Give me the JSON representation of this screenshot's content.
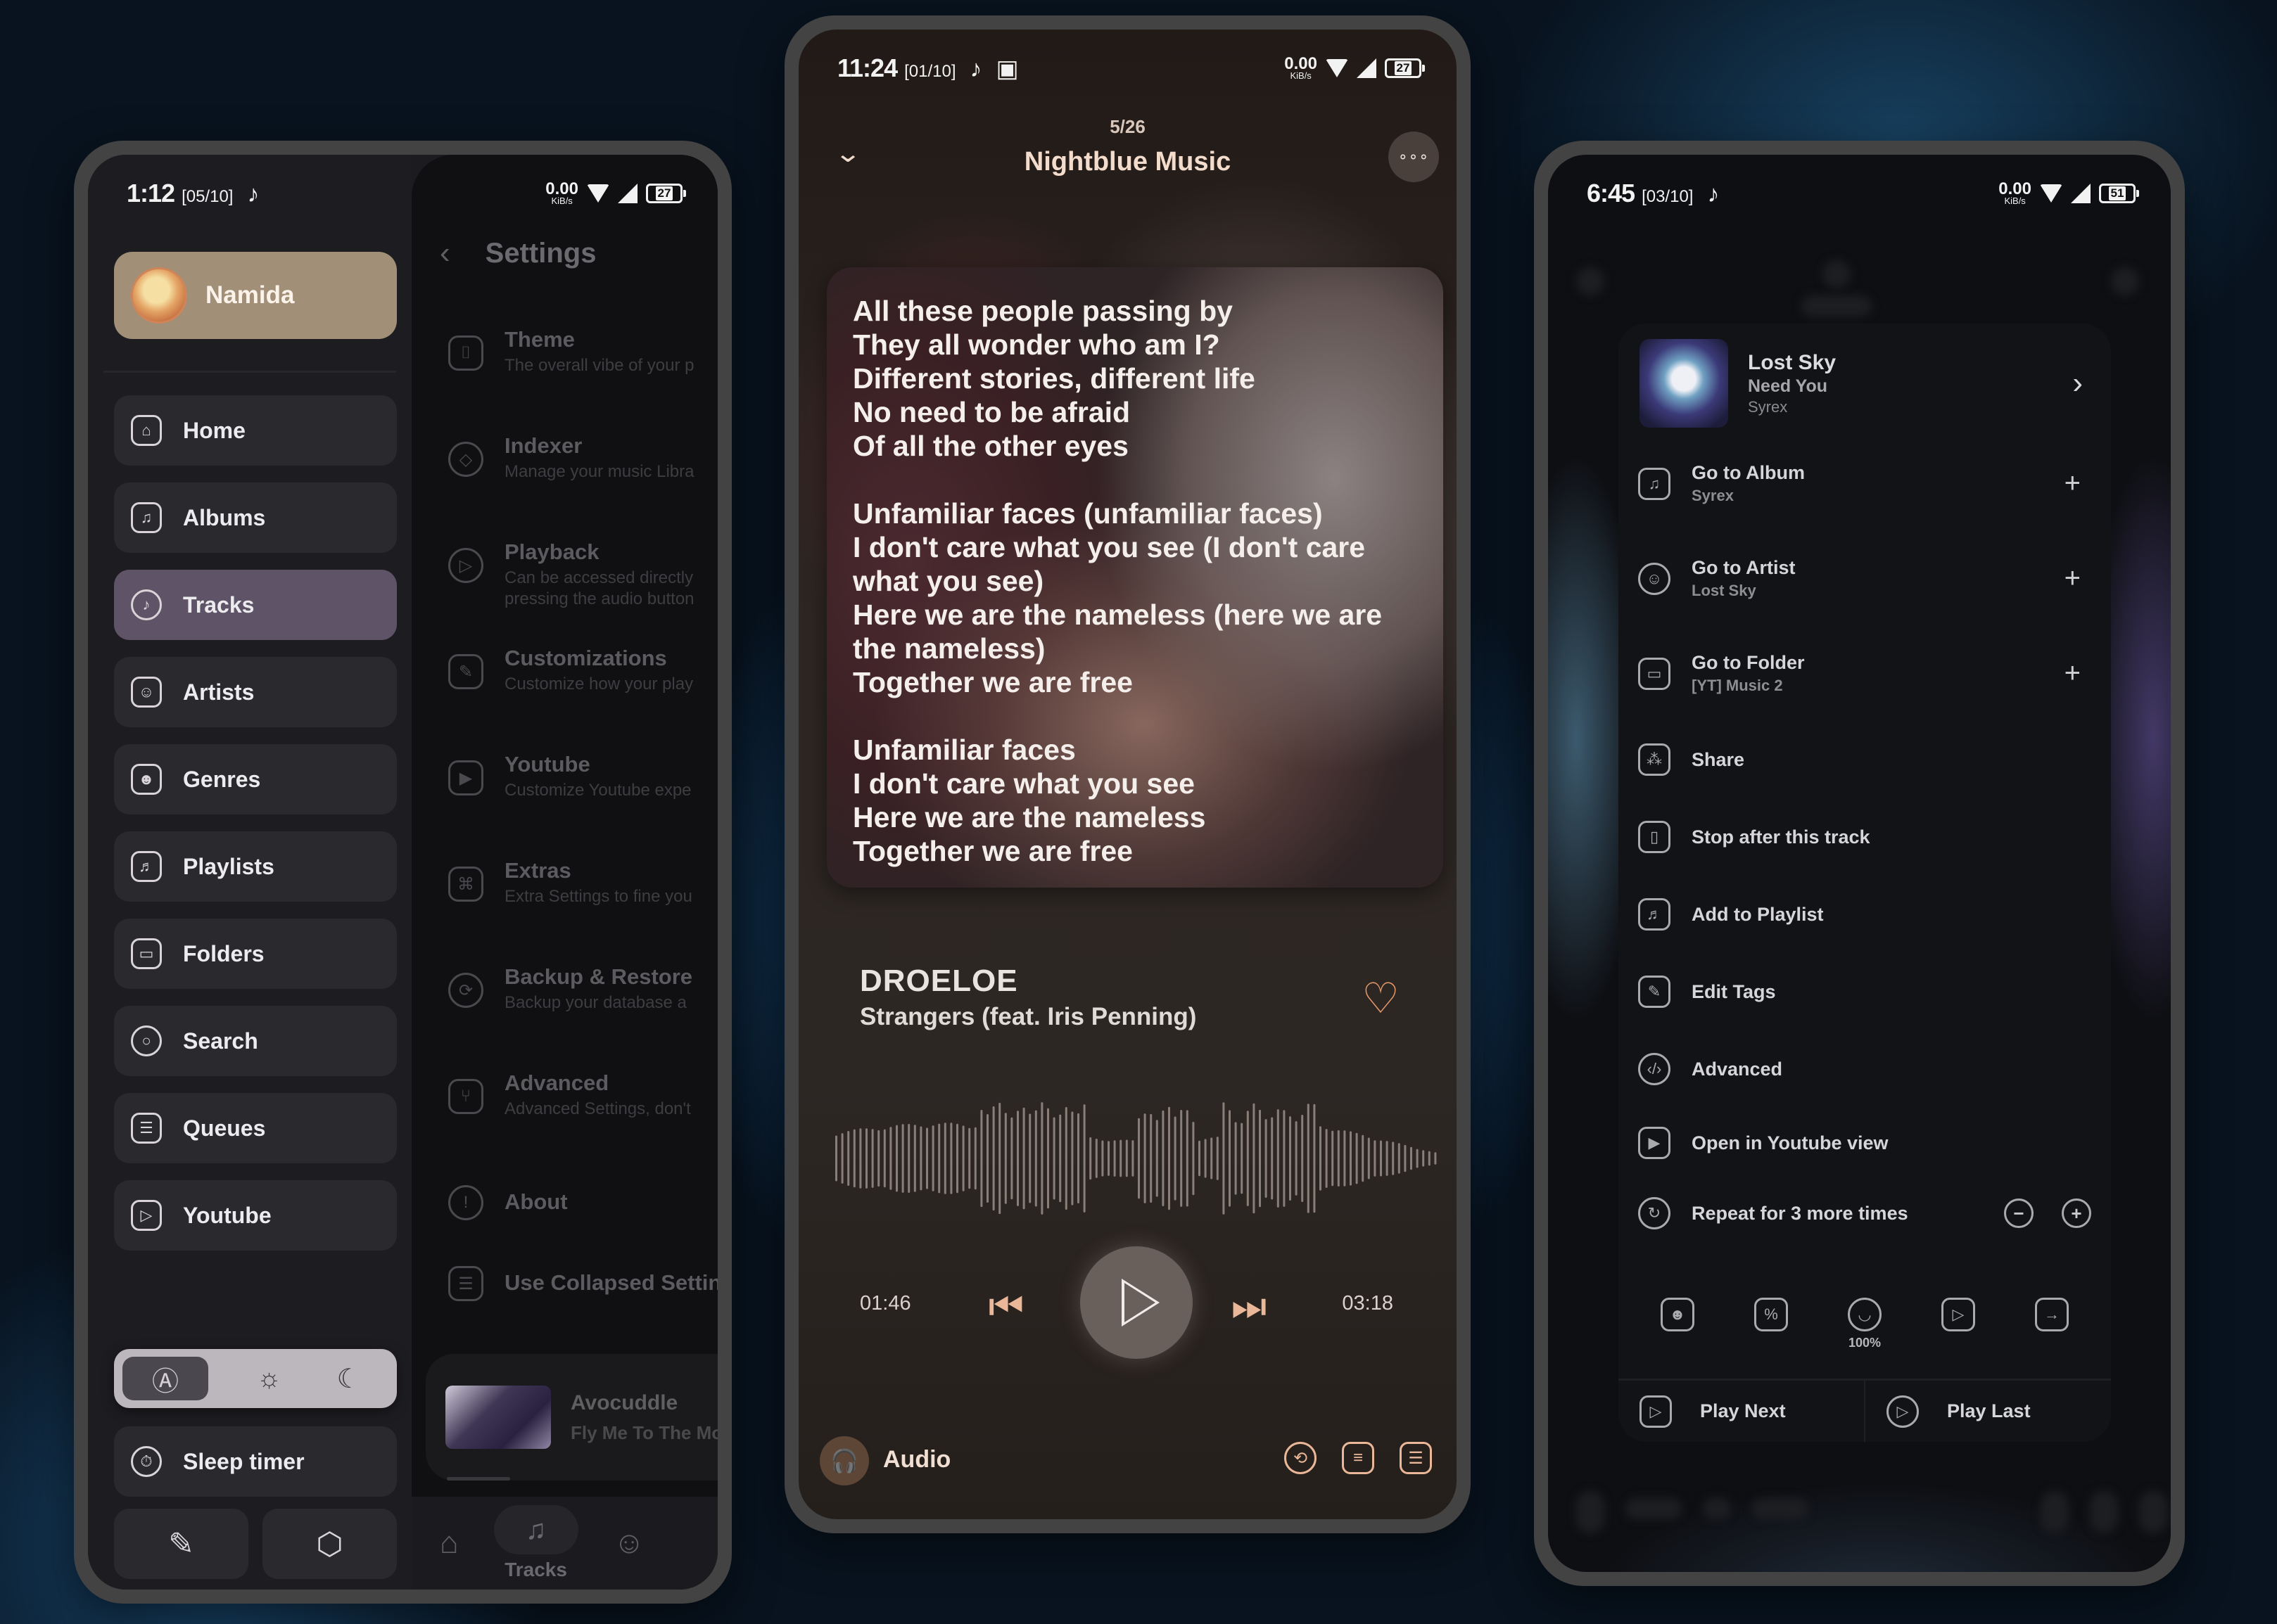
{
  "left_phone": {
    "status": {
      "time": "1:12",
      "date": "[05/10]",
      "net_speed": "0.00",
      "net_unit": "KiB/s",
      "battery": "27"
    },
    "profile": {
      "name": "Namida"
    },
    "nav": [
      {
        "label": "Home",
        "icon": "home-icon",
        "glyph": "⌂",
        "active": false
      },
      {
        "label": "Albums",
        "icon": "album-icon",
        "glyph": "♫",
        "active": false
      },
      {
        "label": "Tracks",
        "icon": "music-disc-icon",
        "glyph": "♪",
        "active": true
      },
      {
        "label": "Artists",
        "icon": "artists-icon",
        "glyph": "☺",
        "active": false
      },
      {
        "label": "Genres",
        "icon": "genres-icon",
        "glyph": "☻",
        "active": false
      },
      {
        "label": "Playlists",
        "icon": "playlist-icon",
        "glyph": "♬",
        "active": false
      },
      {
        "label": "Folders",
        "icon": "folder-icon",
        "glyph": "▭",
        "active": false
      },
      {
        "label": "Search",
        "icon": "search-icon",
        "glyph": "○",
        "active": false
      },
      {
        "label": "Queues",
        "icon": "queues-icon",
        "glyph": "☰",
        "active": false
      },
      {
        "label": "Youtube",
        "icon": "youtube-icon",
        "glyph": "▷",
        "active": false
      }
    ],
    "theme_modes": [
      {
        "icon": "auto-theme-icon",
        "glyph": "Ⓐ",
        "active": true
      },
      {
        "icon": "light-theme-icon",
        "glyph": "☼",
        "active": false
      },
      {
        "icon": "dark-theme-icon",
        "glyph": "☾",
        "active": false
      }
    ],
    "sleep_timer_label": "Sleep timer",
    "sleep_timer_glyph": "⏱",
    "bottom_buttons": [
      {
        "icon": "customize-brush-icon",
        "glyph": "✎"
      },
      {
        "icon": "settings-gear-icon",
        "glyph": "⬡"
      }
    ],
    "settings": {
      "title": "Settings",
      "back_glyph": "‹",
      "items": [
        {
          "title": "Theme",
          "subtitle": "The overall vibe of your p",
          "icon": "theme-brush-icon",
          "glyph": "⌷"
        },
        {
          "title": "Indexer",
          "subtitle": "Manage your music Libra",
          "icon": "indexer-icon",
          "glyph": "◇"
        },
        {
          "title": "Playback",
          "subtitle": "Can be accessed directly\npressing the audio button",
          "icon": "playback-icon",
          "glyph": "▷"
        },
        {
          "title": "Customizations",
          "subtitle": "Customize how your play",
          "icon": "customizations-icon",
          "glyph": "✎"
        },
        {
          "title": "Youtube",
          "subtitle": "Customize Youtube expe",
          "icon": "youtube-video-icon",
          "glyph": "▶"
        },
        {
          "title": "Extras",
          "subtitle": "Extra Settings to fine you",
          "icon": "extras-command-icon",
          "glyph": "⌘"
        },
        {
          "title": "Backup & Restore",
          "subtitle": "Backup your database a",
          "icon": "backup-restore-icon",
          "glyph": "⟳"
        },
        {
          "title": "Advanced",
          "subtitle": "Advanced Settings, don't",
          "icon": "advanced-branch-icon",
          "glyph": "⑂"
        },
        {
          "title": "About",
          "subtitle": "",
          "icon": "about-info-icon",
          "glyph": "!"
        },
        {
          "title": "Use Collapsed Settin",
          "subtitle": "",
          "icon": "collapsed-settings-icon",
          "glyph": "☰"
        }
      ]
    },
    "miniplayer": {
      "artist": "Avocuddle",
      "title": "Fly Me To The Moo"
    },
    "bottom_nav": [
      {
        "icon": "home-icon",
        "glyph": "⌂",
        "label": ""
      },
      {
        "icon": "tracks-icon",
        "glyph": "♫",
        "label": "Tracks",
        "active": true
      },
      {
        "icon": "artists-icon",
        "glyph": "☺",
        "label": ""
      }
    ]
  },
  "middle_phone": {
    "status": {
      "time": "11:24",
      "date": "[01/10]",
      "net_speed": "0.00",
      "net_unit": "KiB/s",
      "battery": "27"
    },
    "queue_position": "5/26",
    "title": "Nightblue Music",
    "more_glyph": "∘∘∘",
    "collapse_glyph": "⌄",
    "lyrics": [
      "All these people passing by",
      "They all wonder who am I?",
      "Different stories, different life",
      "No need to be afraid",
      "Of all the other eyes",
      "",
      "Unfamiliar faces (unfamiliar faces)",
      "I don't care what you see (I don't care what you see)",
      "Here we are the nameless (here we are the nameless)",
      "Together we are free",
      "",
      "Unfamiliar faces",
      "I don't care what you see",
      "Here we are the nameless",
      "Together we are free"
    ],
    "track": {
      "artist": "DROELOE",
      "title": "Strangers (feat. Iris Penning)"
    },
    "favourite_glyph": "♡",
    "current_time": "01:46",
    "total_time": "03:18",
    "progress_fraction": 0.55,
    "prev_glyph": "⏮",
    "next_glyph": "⏭",
    "audio_label": "Audio",
    "audio_glyph": "🎧",
    "bottom_icons": [
      {
        "icon": "repeat-icon",
        "glyph": "⟲"
      },
      {
        "icon": "lyrics-icon",
        "glyph": "≡"
      },
      {
        "icon": "queue-icon",
        "glyph": "☰"
      }
    ],
    "accent_color": "#eab899"
  },
  "right_phone": {
    "status": {
      "time": "6:45",
      "date": "[03/10]",
      "net_speed": "0.00",
      "net_unit": "KiB/s",
      "battery": "51"
    },
    "track": {
      "title": "Lost Sky",
      "album": "Need You",
      "artist": "Syrex"
    },
    "menu": [
      {
        "label": "Go to Album",
        "sublabel": "Syrex",
        "icon": "album-icon",
        "glyph": "♫",
        "plus": true
      },
      {
        "label": "Go to Artist",
        "sublabel": "Lost Sky",
        "icon": "artist-mic-icon",
        "glyph": "☺",
        "plus": true
      },
      {
        "label": "Go to Folder",
        "sublabel": "[YT] Music 2",
        "icon": "folder-icon",
        "glyph": "▭",
        "plus": true
      },
      {
        "label": "Share",
        "sublabel": "",
        "icon": "share-icon",
        "glyph": "⁂",
        "plus": false
      },
      {
        "label": "Stop after this track",
        "sublabel": "",
        "icon": "stop-after-icon",
        "glyph": "▯",
        "plus": false
      },
      {
        "label": "Add to Playlist",
        "sublabel": "",
        "icon": "add-playlist-icon",
        "glyph": "♬",
        "plus": false
      },
      {
        "label": "Edit Tags",
        "sublabel": "",
        "icon": "edit-tags-icon",
        "glyph": "✎",
        "plus": false
      },
      {
        "label": "Advanced",
        "sublabel": "",
        "icon": "advanced-code-icon",
        "glyph": "‹/›",
        "plus": false
      },
      {
        "label": "Open in Youtube view",
        "sublabel": "",
        "icon": "youtube-video-icon",
        "glyph": "▶",
        "plus": false
      }
    ],
    "repeat": {
      "label": "Repeat for 3 more times",
      "minus_glyph": "−",
      "plus_glyph": "+"
    },
    "icon_row": [
      {
        "icon": "genres-icon",
        "glyph": "☻",
        "label": ""
      },
      {
        "icon": "discount-ticket-icon",
        "glyph": "%",
        "label": ""
      },
      {
        "icon": "rating-icon",
        "glyph": "◡",
        "label": "100%"
      },
      {
        "icon": "set-cover-icon",
        "glyph": "▷",
        "label": ""
      },
      {
        "icon": "import-arrow-icon",
        "glyph": "→",
        "label": ""
      }
    ],
    "footer": [
      {
        "label": "Play Next",
        "icon": "play-next-icon",
        "glyph": "▷"
      },
      {
        "label": "Play Last",
        "icon": "play-last-icon",
        "glyph": "▷"
      }
    ],
    "chevron_glyph": "›",
    "plus_glyph": "+"
  }
}
